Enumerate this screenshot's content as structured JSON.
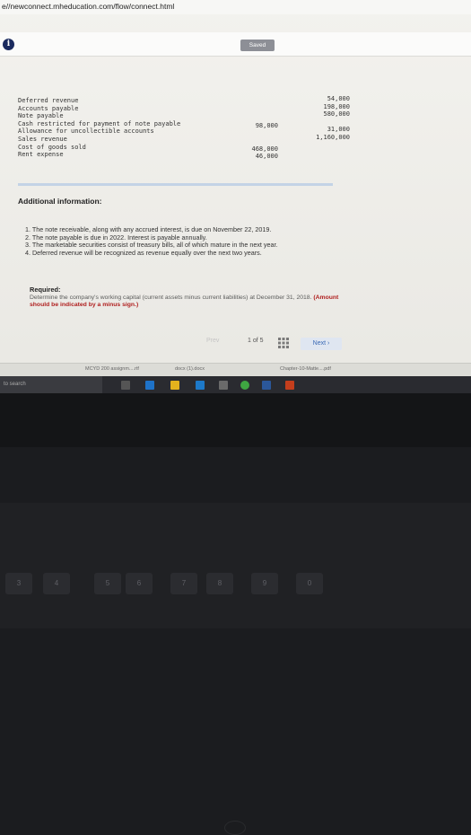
{
  "browser": {
    "url": "e//newconnect.mheducation.com/flow/connect.html"
  },
  "header": {
    "info_glyph": "i",
    "saved_label": "Saved"
  },
  "ledger": [
    {
      "account": "Deferred revenue",
      "debit": "",
      "credit": "54,000"
    },
    {
      "account": "Accounts payable",
      "debit": "",
      "credit": "198,000"
    },
    {
      "account": "Note payable",
      "debit": "",
      "credit": "580,000"
    },
    {
      "account": "Cash restricted for payment of note payable",
      "debit": "98,000",
      "credit": ""
    },
    {
      "account": "Allowance for uncollectible accounts",
      "debit": "",
      "credit": "31,000"
    },
    {
      "account": "Sales revenue",
      "debit": "",
      "credit": "1,160,000"
    },
    {
      "account": "Cost of goods sold",
      "debit": "468,000",
      "credit": ""
    },
    {
      "account": "Rent expense",
      "debit": "46,000",
      "credit": ""
    }
  ],
  "additional": {
    "heading": "Additional information:",
    "notes": [
      "1. The note receivable, along with any accrued interest, is due on November 22, 2019.",
      "2. The note payable is due in 2022. Interest is payable annually.",
      "3. The marketable securities consist of treasury bills, all of which mature in the next year.",
      "4. Deferred revenue will be recognized as revenue equally over the next two years."
    ]
  },
  "required": {
    "heading": "Required:",
    "text": "Determine the company's working capital (current assets minus current liabilities) at December 31, 2018.",
    "note_red": "(Amount",
    "text2": "should be indicated by a minus sign.)"
  },
  "pager": {
    "prev_label": "Prev",
    "page_label": "1 of 5",
    "next_label": "Next"
  },
  "taskbar_downloads": [
    "MCYD 200 assignm....rtf",
    "docx (1).docx",
    "Chapter-10-Matte....pdf"
  ],
  "windows": {
    "search_placeholder": "to search"
  },
  "keys": [
    "3",
    "4",
    "5",
    "6",
    "7",
    "8",
    "9",
    "0"
  ],
  "colors": {
    "saved_badge": "#8d8f96",
    "info_icon": "#1a2a5e",
    "next_button_text": "#3a6ab5",
    "required_note": "#b02020"
  }
}
